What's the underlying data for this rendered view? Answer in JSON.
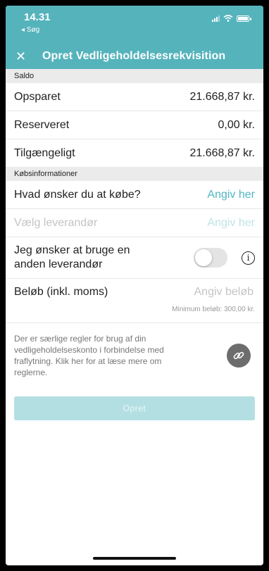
{
  "status_bar": {
    "time": "14.31",
    "back_label": "◂ Søg"
  },
  "header": {
    "close_glyph": "✕",
    "title": "Opret Vedligeholdelsesrekvisition"
  },
  "saldo": {
    "section_label": "Saldo",
    "rows": [
      {
        "label": "Opsparet",
        "value": "21.668,87 kr."
      },
      {
        "label": "Reserveret",
        "value": "0,00 kr."
      },
      {
        "label": "Tilgængeligt",
        "value": "21.668,87 kr."
      }
    ]
  },
  "purchase": {
    "section_label": "Købsinformationer",
    "what_label": "Hvad ønsker du at købe?",
    "what_action": "Angiv her",
    "supplier_label": "Vælg leverandør",
    "supplier_action": "Angiv her",
    "other_supplier_label": "Jeg ønsker at bruge en anden leverandør",
    "other_supplier_toggle": false,
    "info_glyph": "i",
    "amount_label": "Beløb (inkl. moms)",
    "amount_placeholder": "Angiv beløb",
    "amount_value": "",
    "min_amount_note": "Minimum beløb: 300,00 kr."
  },
  "rules_info": {
    "text": "Der er særlige regler for brug af din vedligeholdelseskonto i forbindelse med fraflytning. Klik her for at læse mere om reglerne.",
    "icon": "link-icon"
  },
  "submit_label": "Opret",
  "colors": {
    "accent": "#55b3bb",
    "link": "#4eb7c2",
    "button_disabled": "#b4dfe2"
  }
}
